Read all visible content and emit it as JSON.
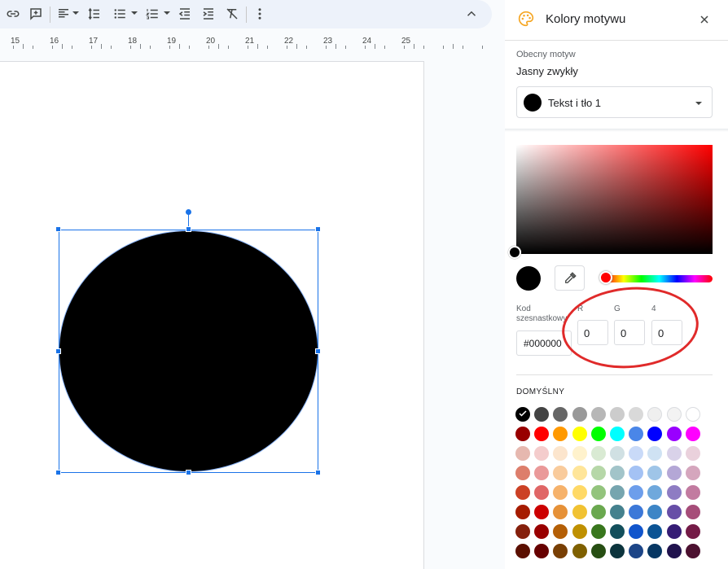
{
  "toolbar": {
    "icons": [
      "link-icon",
      "add-comment-icon",
      "align-icon",
      "line-spacing-icon",
      "bulleted-list-icon",
      "numbered-list-icon",
      "decrease-indent-icon",
      "increase-indent-icon",
      "clear-formatting-icon",
      "more-icon",
      "collapse-icon"
    ]
  },
  "ruler": {
    "numbers": [
      "15",
      "16",
      "17",
      "18",
      "19",
      "20",
      "21",
      "22",
      "23",
      "24",
      "25"
    ]
  },
  "panel": {
    "title": "Kolory motywu",
    "current_theme_label": "Obecny motyw",
    "current_theme_value": "Jasny zwykły",
    "dropdown_value": "Tekst i tło 1",
    "hex_label": "Kod szesnastkowy",
    "hex_value": "#000000",
    "channels": [
      {
        "label": "R",
        "value": "0"
      },
      {
        "label": "G",
        "value": "0"
      },
      {
        "label": "4",
        "value": "0"
      }
    ],
    "default_label": "DOMYŚLNY",
    "selected_color": "#000000",
    "palette": [
      [
        "#000000",
        "#434343",
        "#666666",
        "#999999",
        "#b7b7b7",
        "#cccccc",
        "#d9d9d9",
        "#efefef",
        "#f3f3f3",
        "#ffffff"
      ],
      [
        "#980000",
        "#ff0000",
        "#ff9900",
        "#ffff00",
        "#00ff00",
        "#00ffff",
        "#4a86e8",
        "#0000ff",
        "#9900ff",
        "#ff00ff"
      ],
      [
        "#e6b8af",
        "#f4cccc",
        "#fce5cd",
        "#fff2cc",
        "#d9ead3",
        "#d0e0e3",
        "#c9daf8",
        "#cfe2f3",
        "#d9d2e9",
        "#ead1dc"
      ],
      [
        "#dd7e6b",
        "#ea9999",
        "#f9cb9c",
        "#ffe599",
        "#b6d7a8",
        "#a2c4c9",
        "#a4c2f4",
        "#9fc5e8",
        "#b4a7d6",
        "#d5a6bd"
      ],
      [
        "#cc4125",
        "#e06666",
        "#f6b26b",
        "#ffd966",
        "#93c47d",
        "#76a5af",
        "#6d9eeb",
        "#6fa8dc",
        "#8e7cc3",
        "#c27ba0"
      ],
      [
        "#a61c00",
        "#cc0000",
        "#e69138",
        "#f1c232",
        "#6aa84f",
        "#45818e",
        "#3c78d8",
        "#3d85c6",
        "#674ea7",
        "#a64d79"
      ],
      [
        "#85200c",
        "#990000",
        "#b45f06",
        "#bf9000",
        "#38761d",
        "#134f5c",
        "#1155cc",
        "#0b5394",
        "#351c75",
        "#741b47"
      ],
      [
        "#5b0f00",
        "#660000",
        "#783f04",
        "#7f6000",
        "#274e13",
        "#0c343d",
        "#1c4587",
        "#073763",
        "#20124d",
        "#4c1130"
      ]
    ]
  }
}
